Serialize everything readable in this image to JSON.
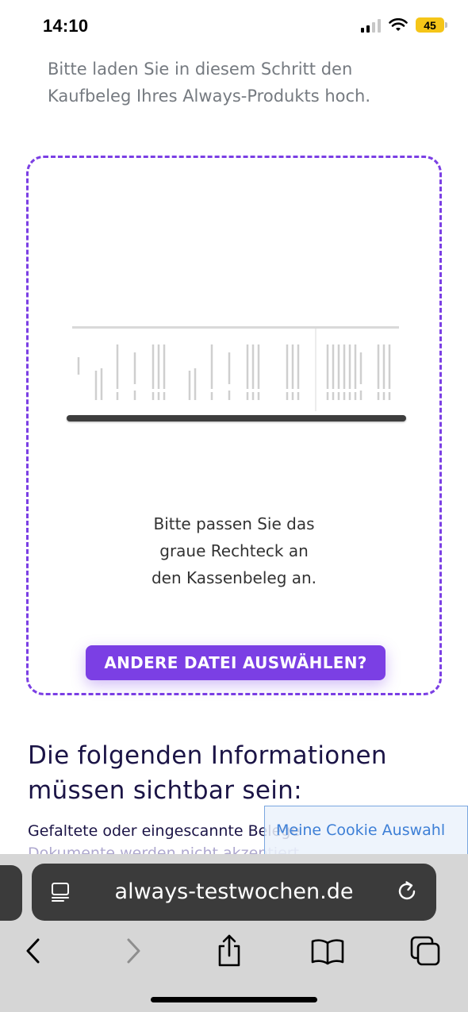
{
  "status_bar": {
    "time": "14:10",
    "battery": "45",
    "icons": [
      "signal-icon",
      "wifi-icon",
      "battery-icon"
    ]
  },
  "intro_text": "Bitte laden Sie in diesem Schritt den Kaufbeleg Ihres Always-Produkts hoch.",
  "upload": {
    "adjust_line1": "Bitte passen Sie das",
    "adjust_line2": "graue Rechteck an",
    "adjust_line3": "den Kassenbeleg an.",
    "select_button_label": "ANDERE DATEI AUSWÄHLEN?"
  },
  "info": {
    "heading_line1": "Die folgenden Informationen",
    "heading_line2": "müssen sichtbar sein:",
    "text_line1": "Gefaltete oder eingescannte Belege",
    "text_line2": "Dokumente werden nicht akzeptiert"
  },
  "cookie_button_label": "Meine Cookie Auswahl",
  "browser": {
    "url": "always-testwochen.de",
    "toolbar_icons": [
      "back-icon",
      "forward-icon",
      "share-icon",
      "bookmarks-icon",
      "tabs-icon"
    ]
  },
  "colors": {
    "accent": "#7b3fe4",
    "heading": "#1b1446",
    "cookie": "#3d7fd6",
    "battery": "#f5c518"
  }
}
